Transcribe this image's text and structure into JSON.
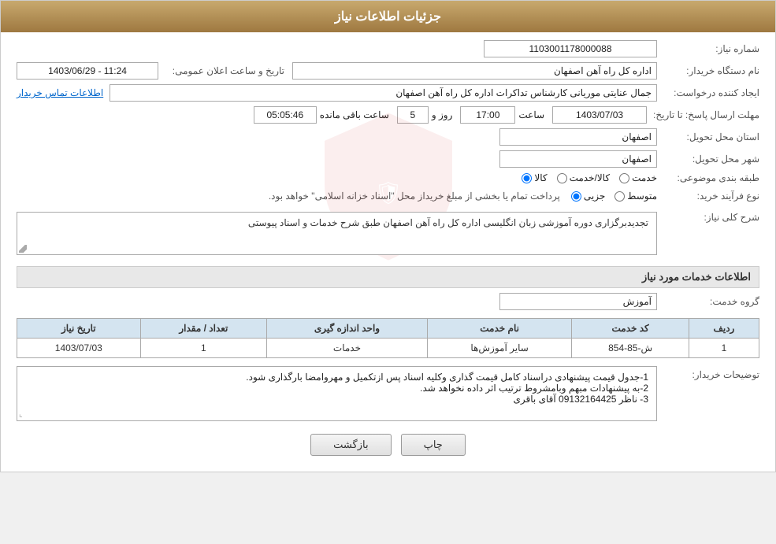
{
  "header": {
    "title": "جزئیات اطلاعات نیاز"
  },
  "fields": {
    "need_number_label": "شماره نیاز:",
    "need_number_value": "1103001178000088",
    "buyer_org_label": "نام دستگاه خریدار:",
    "buyer_org_value": "اداره کل راه آهن اصفهان",
    "creator_label": "ایجاد کننده درخواست:",
    "creator_value": "جمال عنایتی موریانی کارشناس تداکرات اداره کل راه آهن اصفهان",
    "creator_link": "اطلاعات تماس خریدار",
    "announce_datetime_label": "تاریخ و ساعت اعلان عمومی:",
    "announce_datetime_value": "1403/06/29 - 11:24",
    "reply_deadline_label": "مهلت ارسال پاسخ: تا تاریخ:",
    "reply_date_value": "1403/07/03",
    "reply_time_label": "ساعت",
    "reply_time_value": "17:00",
    "reply_days_label": "روز و",
    "reply_days_value": "5",
    "reply_remaining_label": "ساعت باقی مانده",
    "reply_remaining_value": "05:05:46",
    "delivery_province_label": "استان محل تحویل:",
    "delivery_province_value": "اصفهان",
    "delivery_city_label": "شهر محل تحویل:",
    "delivery_city_value": "اصفهان",
    "category_label": "طبقه بندی موضوعی:",
    "category_options": [
      "کالا",
      "خدمت",
      "کالا/خدمت"
    ],
    "category_selected": "کالا",
    "purchase_type_label": "نوع فرآیند خرید:",
    "purchase_type_options": [
      "جزیی",
      "متوسط"
    ],
    "purchase_type_note": "پرداخت تمام یا بخشی از مبلغ خریداز محل \"اسناد خزانه اسلامی\" خواهد بود.",
    "need_desc_label": "شرح کلی نیاز:",
    "need_desc_value": "تجدیدبرگزاری دوره آموزشی زبان انگلیسی اداره کل راه آهن اصفهان طبق شرح خدمات و اسناد پیوستی",
    "service_info_label": "اطلاعات خدمات مورد نیاز",
    "service_group_label": "گروه خدمت:",
    "service_group_value": "آموزش",
    "table": {
      "headers": [
        "ردیف",
        "کد خدمت",
        "نام خدمت",
        "واحد اندازه گیری",
        "تعداد / مقدار",
        "تاریخ نیاز"
      ],
      "rows": [
        {
          "row": "1",
          "code": "ش-85-854",
          "name": "سایر آموزش‌ها",
          "unit": "خدمات",
          "quantity": "1",
          "date": "1403/07/03"
        }
      ]
    },
    "buyer_notes_label": "توضیحات خریدار:",
    "buyer_notes_value": "1-جدول قیمت پیشنهادی دراسناد کامل قیمت گذاری  وکلیه اسناد پس ازتکمیل و مهروامضا بارگذاری شود.\n2-به پیشنهادات مبهم وبامشروط ترتیب اثر داده نخواهد شد.\n3- ناظر 09132164425 آقای باقری",
    "back_button": "بازگشت",
    "print_button": "چاپ"
  }
}
